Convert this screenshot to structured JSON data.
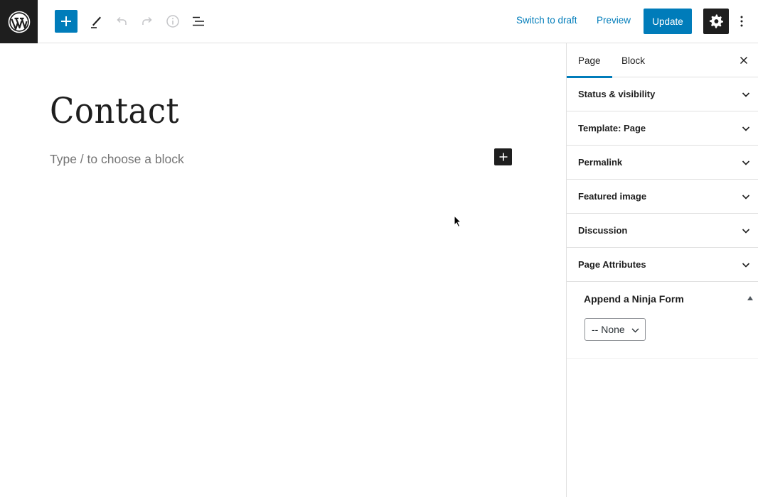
{
  "header": {
    "switch_to_draft": "Switch to draft",
    "preview": "Preview",
    "update": "Update"
  },
  "editor": {
    "title": "Contact",
    "placeholder": "Type / to choose a block"
  },
  "sidebar": {
    "tabs": [
      {
        "label": "Page",
        "active": true
      },
      {
        "label": "Block",
        "active": false
      }
    ],
    "panels": [
      {
        "label": "Status & visibility"
      },
      {
        "label": "Template: Page"
      },
      {
        "label": "Permalink"
      },
      {
        "label": "Featured image"
      },
      {
        "label": "Discussion"
      },
      {
        "label": "Page Attributes"
      }
    ],
    "ninja": {
      "title": "Append a Ninja Form",
      "selected": "-- None"
    }
  },
  "colors": {
    "accent": "#007cba",
    "dark": "#1e1e1e",
    "border": "#e0e0e0"
  }
}
